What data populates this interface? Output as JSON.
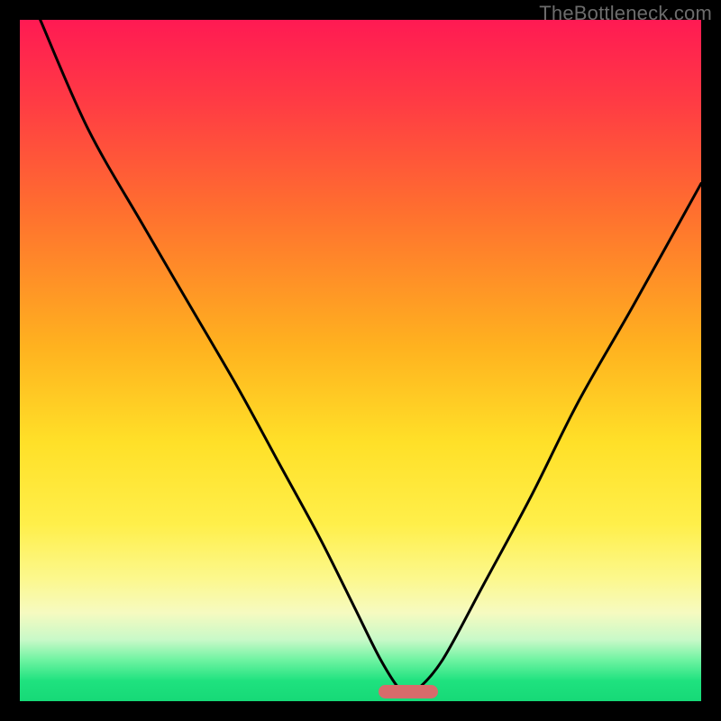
{
  "watermark": {
    "text": "TheBottleneck.com"
  },
  "colors": {
    "pill": "#d86b6b",
    "curve_stroke": "#000000"
  },
  "chart_data": {
    "type": "line",
    "title": "",
    "xlabel": "",
    "ylabel": "",
    "xlim": [
      0,
      100
    ],
    "ylim": [
      0,
      100
    ],
    "grid": false,
    "legend": false,
    "series": [
      {
        "name": "bottleneck-curve",
        "x": [
          3,
          10,
          18,
          25,
          32,
          38,
          44,
          49,
          53,
          56,
          58,
          62,
          68,
          75,
          82,
          90,
          100
        ],
        "y": [
          100,
          84,
          70,
          58,
          46,
          35,
          24,
          14,
          6,
          1.5,
          1.5,
          6,
          17,
          30,
          44,
          58,
          76
        ]
      }
    ],
    "marker": {
      "name": "optimal-range",
      "x_center": 57,
      "width_pct": 8.7
    }
  }
}
